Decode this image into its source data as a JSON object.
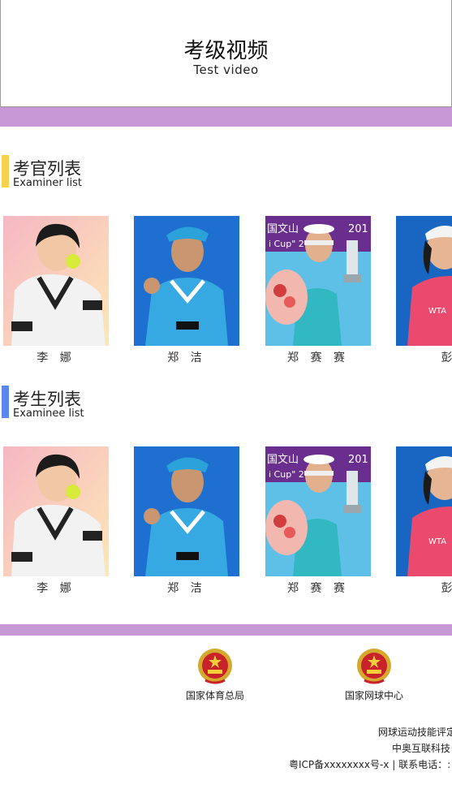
{
  "video": {
    "title": "考级视频",
    "subtitle": "Test video"
  },
  "examiners": {
    "title": "考官列表",
    "subtitle": "Examiner list",
    "accent": "#f5d14c",
    "people": [
      {
        "name": "李 娜"
      },
      {
        "name": "郑 洁"
      },
      {
        "name": "郑 赛 赛"
      },
      {
        "name": "彭"
      }
    ]
  },
  "examinees": {
    "title": "考生列表",
    "subtitle": "Examinee list",
    "accent": "#5b86f0",
    "people": [
      {
        "name": "李 娜"
      },
      {
        "name": "郑 洁"
      },
      {
        "name": "郑 赛 赛"
      },
      {
        "name": "彭"
      }
    ]
  },
  "photo_text": {
    "banner_1": "国文山",
    "banner_2": "201",
    "banner_3": "i Cup\" 2",
    "shirt_1": "WTA",
    "shirt_2": "WTA"
  },
  "footer": {
    "orgs": [
      {
        "label": "国家体育总局",
        "icon": "national-emblem-icon"
      },
      {
        "label": "国家网球中心",
        "icon": "national-emblem-icon"
      }
    ],
    "line1": "网球运动技能评定",
    "line2": "中奥互联科技",
    "line3": "粤ICP备xxxxxxxx号-x | 联系电话：:"
  },
  "colors": {
    "band": "#c797d6",
    "examiner_accent": "#f5d14c",
    "examinee_accent": "#5b86f0"
  }
}
